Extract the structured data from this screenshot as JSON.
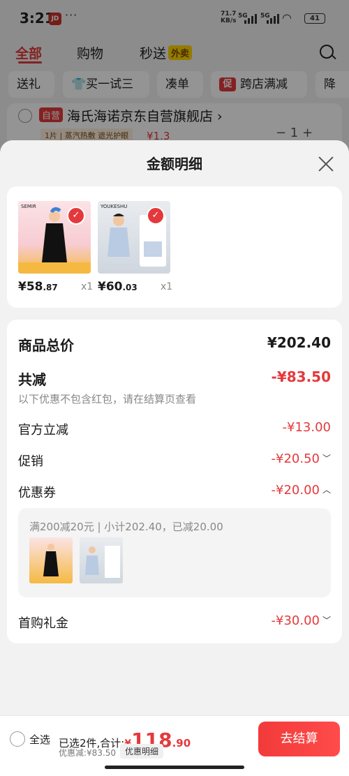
{
  "status_bar": {
    "time": "3:21",
    "dots": "···",
    "net_speed": "71.7",
    "net_unit": "KB/s",
    "sig1": "5G",
    "sig2": "5G",
    "battery": "41"
  },
  "top_tabs": [
    {
      "label": "全部"
    },
    {
      "label": "购物"
    },
    {
      "label": "秒送",
      "badge": "外卖"
    }
  ],
  "chips": [
    "送礼",
    "买一试三",
    "凑单",
    "跨店满减",
    "降"
  ],
  "chip_promo_badge": "促",
  "store": {
    "badge": "自营",
    "name": "海氏海诺京东自营旗舰店 ›",
    "tagline": "1片 | 蒸汽热敷 遮光护眼",
    "price": "¥1.3",
    "qty": "−   1   +"
  },
  "sheet": {
    "title": "金额明细",
    "products": [
      {
        "price_int": "¥58",
        "price_dec": ".87",
        "qty": "x1",
        "thumb_label": "SEMIR"
      },
      {
        "price_int": "¥60",
        "price_dec": ".03",
        "qty": "x1",
        "thumb_label": "YOUKESHU"
      }
    ],
    "summary": {
      "total_label": "商品总价",
      "total_value": "¥202.40",
      "reduce_label": "共减",
      "reduce_value": "-¥83.50",
      "reduce_note": "以下优惠不包含红包，请在结算页查看",
      "rows": [
        {
          "label": "官方立减",
          "value": "-¥13.00"
        },
        {
          "label": "促销",
          "value": "-¥20.50"
        },
        {
          "label": "优惠券",
          "value": "-¥20.00"
        }
      ],
      "coupon_detail": "满200减20元 | 小计202.40，已减20.00",
      "first_buy_label": "首购礼金",
      "first_buy_value": "-¥30.00"
    }
  },
  "bottom_bar": {
    "select_all": "全选",
    "selected_text": "已选2件,合计:",
    "total_symbol": "¥",
    "total_int": "118",
    "total_dec": ".90",
    "saved_text": "优惠减:¥83.50",
    "detail_button": "优惠明细",
    "checkout_button": "去结算"
  },
  "colors": {
    "accent": "#e4393c",
    "sheet_bg": "#f2f2f2"
  }
}
